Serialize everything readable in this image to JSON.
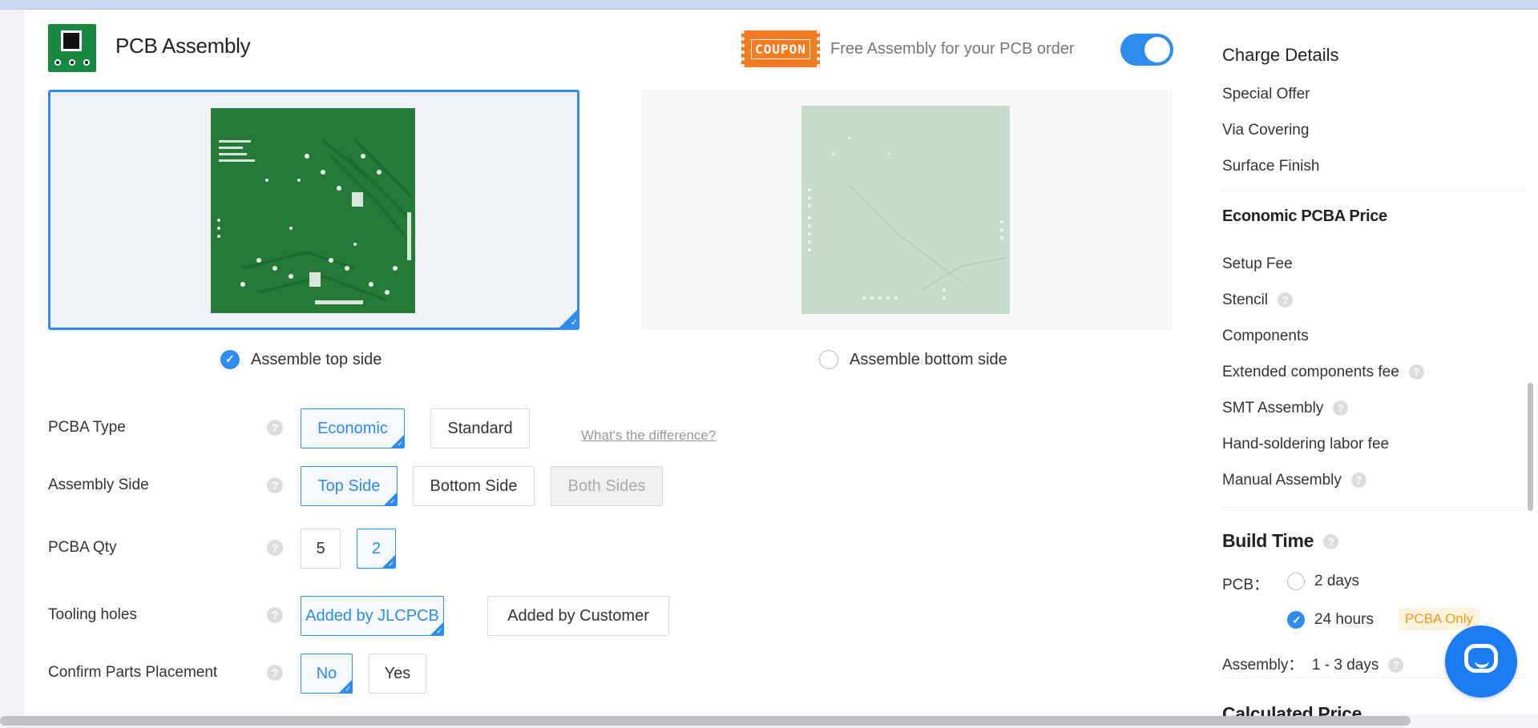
{
  "header": {
    "title": "PCB Assembly",
    "coupon_label": "COUPON",
    "coupon_text": "Free Assembly for your PCB order",
    "toggle_on": true
  },
  "board_sides": {
    "top_label": "Assemble top side",
    "bottom_label": "Assemble bottom side",
    "selected": "top"
  },
  "options": {
    "pcba_type": {
      "label": "PCBA Type",
      "choices": [
        "Economic",
        "Standard"
      ],
      "selected": "Economic",
      "link": "What's the difference?"
    },
    "assembly_side": {
      "label": "Assembly Side",
      "choices": [
        "Top Side",
        "Bottom Side",
        "Both Sides"
      ],
      "selected": "Top Side",
      "disabled": "Both Sides"
    },
    "pcba_qty": {
      "label": "PCBA Qty",
      "choices": [
        "5",
        "2"
      ],
      "selected": "2"
    },
    "tooling_holes": {
      "label": "Tooling holes",
      "choices": [
        "Added by JLCPCB",
        "Added by Customer"
      ],
      "selected": "Added by JLCPCB"
    },
    "confirm_parts": {
      "label": "Confirm Parts Placement",
      "choices": [
        "No",
        "Yes"
      ],
      "selected": "No"
    }
  },
  "sidebar": {
    "charge_title": "Charge Details",
    "charge_items": [
      "Special Offer",
      "Via Covering",
      "Surface Finish"
    ],
    "economic_title": "Economic PCBA Price",
    "economic_items": [
      {
        "label": "Setup Fee",
        "help": false
      },
      {
        "label": "Stencil",
        "help": true
      },
      {
        "label": "Components",
        "help": false
      },
      {
        "label": "Extended components fee",
        "help": true
      },
      {
        "label": "SMT Assembly",
        "help": true
      },
      {
        "label": "Hand-soldering labor fee",
        "help": false
      },
      {
        "label": "Manual Assembly",
        "help": true
      }
    ],
    "build_time_title": "Build Time",
    "pcb_label": "PCB：",
    "pcb_options": [
      "2 days",
      "24 hours"
    ],
    "pcb_selected": "24 hours",
    "pcba_only_badge": "PCBA Only",
    "assembly_label": "Assembly：",
    "assembly_value": "1 - 3 days",
    "calculated_title": "Calculated Price"
  },
  "colors": {
    "accent": "#2d8cf0",
    "coupon": "#f47b20",
    "board_green": "#247a36"
  }
}
